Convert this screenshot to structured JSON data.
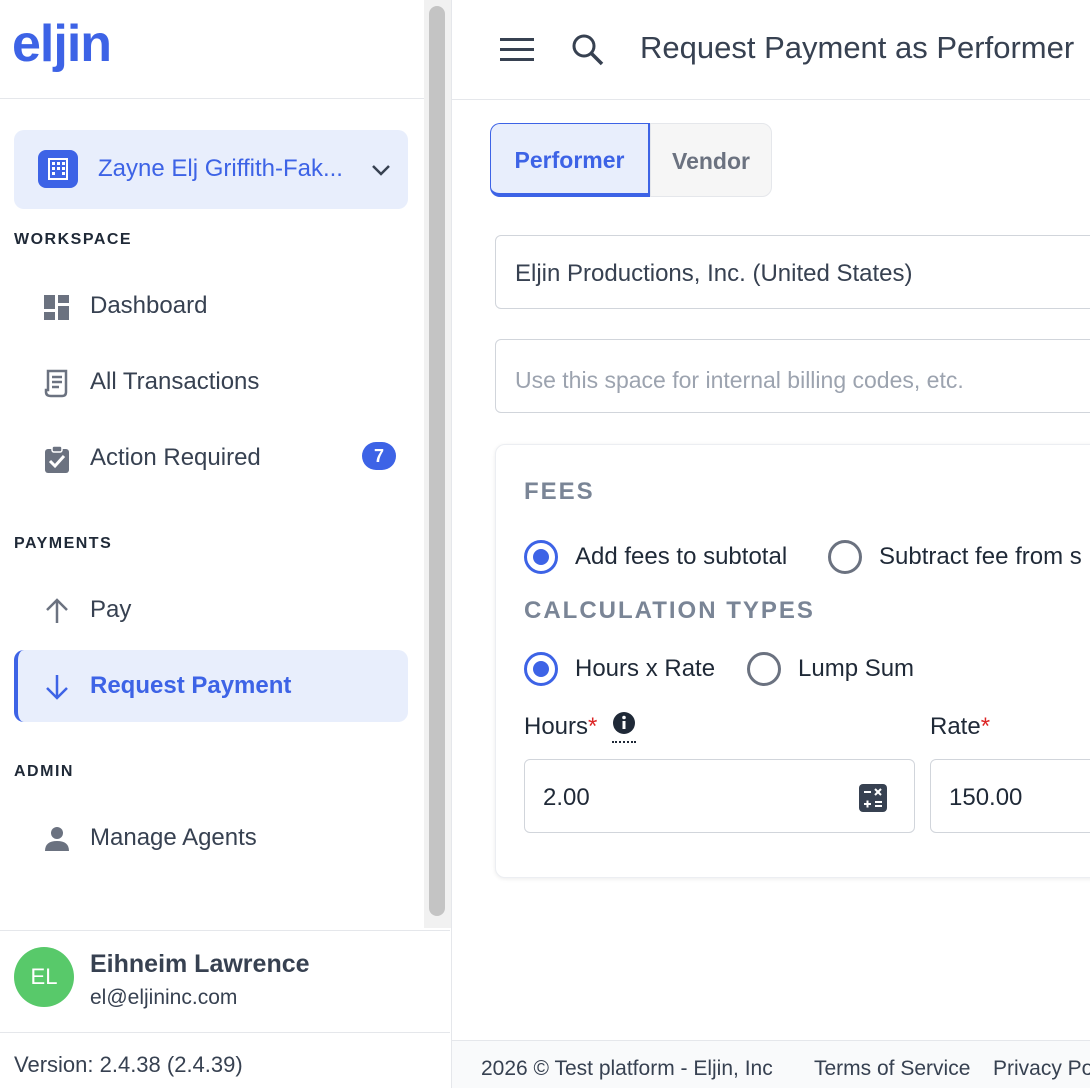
{
  "app": {
    "logo_text": "eljin",
    "brand_color": "#3d63e6"
  },
  "workspace_switcher": {
    "name": "Zayne Elj Griffith-Fak..."
  },
  "sidebar": {
    "sections": {
      "workspace": "WORKSPACE",
      "payments": "PAYMENTS",
      "admin": "ADMIN"
    },
    "items": {
      "dashboard": {
        "label": "Dashboard",
        "icon": "dashboard-icon"
      },
      "all_transactions": {
        "label": "All Transactions",
        "icon": "receipt-icon"
      },
      "action_required": {
        "label": "Action Required",
        "icon": "clipboard-check-icon",
        "badge": "7"
      },
      "pay": {
        "label": "Pay",
        "icon": "arrow-up-icon"
      },
      "request_payment": {
        "label": "Request Payment",
        "icon": "arrow-down-icon",
        "active": true
      },
      "manage_agents": {
        "label": "Manage Agents",
        "icon": "person-icon"
      }
    }
  },
  "user": {
    "initials": "EL",
    "name": "Eihneim Lawrence",
    "email": "el@eljininc.com",
    "avatar_color": "#58c96a"
  },
  "version": "Version: 2.4.38 (2.4.39)",
  "header": {
    "title": "Request Payment as Performer"
  },
  "tabs": {
    "performer": "Performer",
    "vendor": "Vendor",
    "selected": "Performer"
  },
  "form": {
    "company": "Eljin Productions, Inc. (United States)",
    "billing_placeholder": "Use this space for internal billing codes, etc."
  },
  "fees": {
    "heading": "FEES",
    "option_add": "Add fees to subtotal",
    "option_subtract": "Subtract fee from s",
    "selected": "Add fees to subtotal"
  },
  "calculation": {
    "heading": "CALCULATION TYPES",
    "option_hours": "Hours x Rate",
    "option_lump": "Lump Sum",
    "selected": "Hours x Rate",
    "hours_label": "Hours",
    "rate_label": "Rate",
    "required_mark": "*",
    "hours_value": "2.00",
    "rate_value": "150.00"
  },
  "footer": {
    "copyright": "2026 © Test platform - Eljin, Inc",
    "terms": "Terms of Service",
    "privacy": "Privacy Po"
  }
}
